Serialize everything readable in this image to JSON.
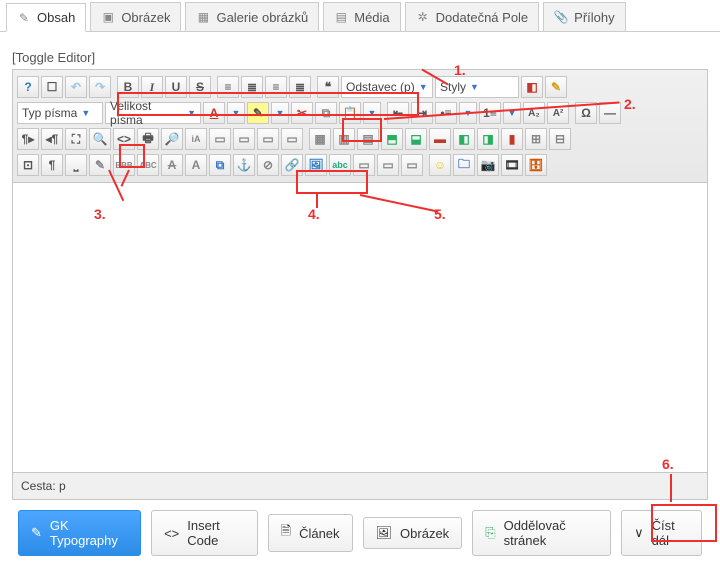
{
  "tabs": {
    "content": "Obsah",
    "image": "Obrázek",
    "gallery": "Galerie obrázků",
    "media": "Média",
    "extrafields": "Dodatečná Pole",
    "attachments": "Přílohy"
  },
  "editor": {
    "toggle": "[Toggle Editor]",
    "format_select": "Odstavec (p)",
    "styles_select": "Styly",
    "fontfamily_select": "Typ písma",
    "fontsize_select": "Velikost písma",
    "path_label": "Cesta:",
    "path_value": "p",
    "spellcheck": "abc",
    "sup": "A²",
    "sub": "A₂",
    "iA": "iA",
    "bbb": "BBB",
    "abc": "ABC",
    "omega": "Ω"
  },
  "buttons": {
    "typography": "GK Typography",
    "insertcode": "Insert Code",
    "article": "Článek",
    "image": "Obrázek",
    "pagebreak": "Oddělovač stránek",
    "readmore": "Číst dál"
  },
  "callouts": {
    "n1": "1.",
    "n2": "2.",
    "n3": "3.",
    "n4": "4.",
    "n5": "5.",
    "n6": "6."
  }
}
